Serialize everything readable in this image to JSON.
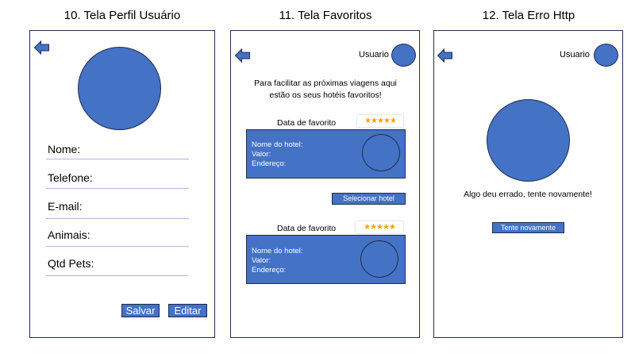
{
  "screens": [
    {
      "title": "10. Tela Perfil Usuário",
      "fields": [
        "Nome:",
        "Telefone:",
        "E-mail:",
        "Animais:",
        "Qtd Pets:"
      ],
      "save_label": "Salvar",
      "edit_label": "Editar"
    },
    {
      "title": "11. Tela Favoritos",
      "user_label": "Usuario",
      "intro_line1": "Para facilitar as próximas viagens aqui",
      "intro_line2": "estão os seus hotéis favoritos!",
      "favorites": [
        {
          "date_label": "Data de favorito",
          "rating": 4.5,
          "name_label": "Nome do hotel:",
          "value_label": "Valor:",
          "address_label": "Endereço:"
        },
        {
          "date_label": "Data de favorito",
          "rating": 4.5,
          "name_label": "Nome do hotel:",
          "value_label": "Valor:",
          "address_label": "Endereço:"
        }
      ],
      "select_label": "Selecionar hotel"
    },
    {
      "title": "12. Tela Erro Http",
      "user_label": "Usuario",
      "error_message": "Algo deu errado, tente novamente!",
      "retry_label": "Tente novamente"
    }
  ],
  "colors": {
    "accent": "#4472c4",
    "border": "#1f2d4d",
    "star": "#f4a300"
  }
}
